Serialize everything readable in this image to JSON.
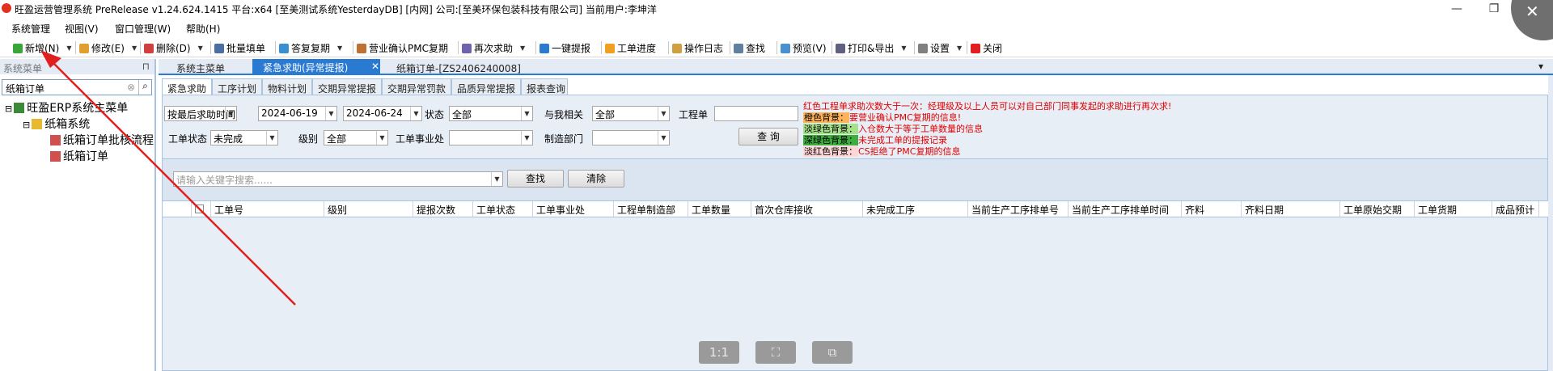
{
  "window": {
    "title": "旺盈运营管理系统 PreRelease v1.24.624.1415 平台:x64  [至美测试系统YesterdayDB] [内网] 公司:[至美环保包装科技有限公司] 当前用户:李坤洋",
    "minimize_icon": "minimize-icon",
    "restore_icon": "restore-icon",
    "close_icon": "close-icon",
    "minimize_glyph": "—",
    "restore_glyph": "❐",
    "close_glyph": "✕"
  },
  "menubar": [
    "系统管理",
    "视图(V)",
    "窗口管理(W)",
    "帮助(H)"
  ],
  "toolbar": [
    {
      "label": "新增(N)",
      "icon": "add-icon",
      "color": "#3aa63a",
      "dropdown": true
    },
    {
      "label": "修改(E)",
      "icon": "edit-icon",
      "color": "#e0a030",
      "dropdown": true
    },
    {
      "label": "删除(D)",
      "icon": "delete-icon",
      "color": "#d04040",
      "dropdown": true
    },
    {
      "label": "批量填单",
      "icon": "batch-fill-icon",
      "color": "#4a6fa5",
      "dropdown": false
    },
    {
      "label": "答复复期",
      "icon": "reply-icon",
      "color": "#3a8fd0",
      "dropdown": true
    },
    {
      "label": "营业确认PMC复期",
      "icon": "confirm-icon",
      "color": "#c07030",
      "dropdown": false
    },
    {
      "label": "再次求助",
      "icon": "help-again-icon",
      "color": "#7060b0",
      "dropdown": true
    },
    {
      "label": "一键提报",
      "icon": "submit-icon",
      "color": "#2a7ad2",
      "dropdown": false
    },
    {
      "label": "工单进度",
      "icon": "progress-icon",
      "color": "#f0a020",
      "dropdown": false
    },
    {
      "label": "操作日志",
      "icon": "log-icon",
      "color": "#d0a040",
      "dropdown": false
    },
    {
      "label": "查找",
      "icon": "find-icon",
      "color": "#6080a0",
      "dropdown": false
    },
    {
      "label": "预览(V)",
      "icon": "preview-icon",
      "color": "#4a90d0",
      "dropdown": false
    },
    {
      "label": "打印&导出",
      "icon": "print-icon",
      "color": "#606080",
      "dropdown": true
    },
    {
      "label": "设置",
      "icon": "settings-icon",
      "color": "#808080",
      "dropdown": true
    },
    {
      "label": "关闭",
      "icon": "close-red-icon",
      "color": "#e02020",
      "dropdown": false
    }
  ],
  "left_panel": {
    "header": "系统菜单",
    "pin_icon": "pin-icon",
    "pin_glyph": "⊓",
    "search_value": "纸箱订单",
    "clear_icon": "clear-icon",
    "clear_glyph": "⊗",
    "search_icon": "search-icon",
    "search_glyph": "⌕",
    "tree": [
      {
        "label": "旺盈ERP系统主菜单",
        "icon": "root-menu-icon",
        "expander": "⊟"
      },
      {
        "label": "纸箱系统",
        "icon": "folder-icon",
        "expander": "⊟"
      },
      {
        "label": "纸箱订单批核流程",
        "icon": "module-icon",
        "expander": ""
      },
      {
        "label": "纸箱订单",
        "icon": "module-icon",
        "expander": ""
      }
    ]
  },
  "tabs": {
    "items": [
      "系统主菜单",
      "紧急求助(异常提报)",
      "纸箱订单-[ZS2406240008]"
    ],
    "active_index": 1,
    "close_glyph": "✕",
    "overflow_glyph": "▾"
  },
  "subtabs": {
    "items": [
      "紧急求助",
      "工序计划",
      "物料计划",
      "交期异常提报",
      "交期异常罚款",
      "品质异常提报",
      "报表查询"
    ],
    "active_index": 0
  },
  "filters": {
    "sort_by": "按最后求助时间",
    "date_from": "2024-06-19",
    "date_to": "2024-06-24",
    "status_label": "状态",
    "status_value": "全部",
    "related_label": "与我相关",
    "related_value": "全部",
    "workorder_label": "工程单",
    "workorder_value": "",
    "wo_status_label": "工单状态",
    "wo_status_value": "未完成",
    "level_label": "级别",
    "level_value": "全部",
    "division_label": "工单事业处",
    "division_value": "",
    "dept_label": "制造部门",
    "dept_value": "",
    "query_button": "查 询"
  },
  "legend_notes": [
    {
      "tag": "",
      "text": "红色工程单求助次数大于一次：经理级及以上人员可以对自己部门同事发起的求助进行再次求!",
      "tag_color": ""
    },
    {
      "tag": "橙色背景：",
      "text": "要营业确认PMC复期的信息!",
      "tag_color": "#ffb35a"
    },
    {
      "tag": "淡绿色背景：",
      "text": "入仓数大于等于工单数量的信息",
      "tag_color": "#a6e08a"
    },
    {
      "tag": "深绿色背景：",
      "text": "未完成工单的提报记录",
      "tag_color": "#3fae3f"
    },
    {
      "tag": "淡红色背景：",
      "text": "CS拒绝了PMC复期的信息",
      "tag_color": "#ffd6d6"
    }
  ],
  "keyword_search": {
    "placeholder": "请输入关键字搜索......",
    "search_button": "查找",
    "clear_button": "清除"
  },
  "grid": {
    "columns": [
      "工单号",
      "级别",
      "提报次数",
      "工单状态",
      "工单事业处",
      "工程单制造部",
      "工单数量",
      "首次仓库接收",
      "未完成工序",
      "当前生产工序排单号",
      "当前生产工序排单时间",
      "齐料",
      "齐料日期",
      "工单原始交期",
      "工单货期",
      "成品预计"
    ],
    "rows": []
  },
  "bottom_controls": [
    {
      "label": "1:1",
      "icon": "actual-size-icon"
    },
    {
      "label": "⛶",
      "icon": "fit-screen-icon"
    },
    {
      "label": "⧉",
      "icon": "screenshot-icon"
    }
  ],
  "colors": {
    "accent": "#2a7ad2",
    "note_red": "#e00000",
    "annotation_arrow": "#e02020"
  }
}
